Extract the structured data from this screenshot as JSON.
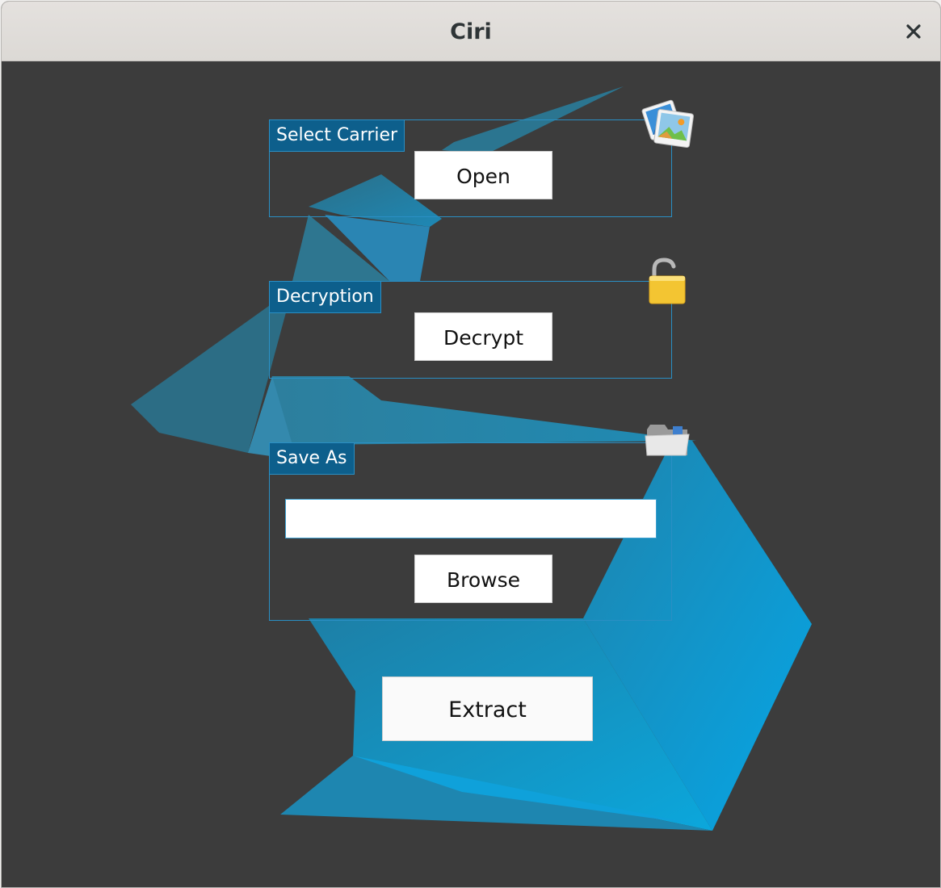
{
  "window": {
    "title": "Ciri",
    "close_icon": "close-icon"
  },
  "carrier": {
    "label": "Select Carrier",
    "button_label": "Open",
    "icon": "image-gallery-icon"
  },
  "decryption": {
    "label": "Decryption",
    "button_label": "Decrypt",
    "icon": "unlocked-padlock-icon"
  },
  "save_as": {
    "label": "Save As",
    "path_value": "",
    "button_label": "Browse",
    "icon": "folder-icon"
  },
  "extract": {
    "button_label": "Extract"
  },
  "colors": {
    "background": "#3c3c3c",
    "accent": "#0d5f8c",
    "border": "#2a8fc4"
  }
}
